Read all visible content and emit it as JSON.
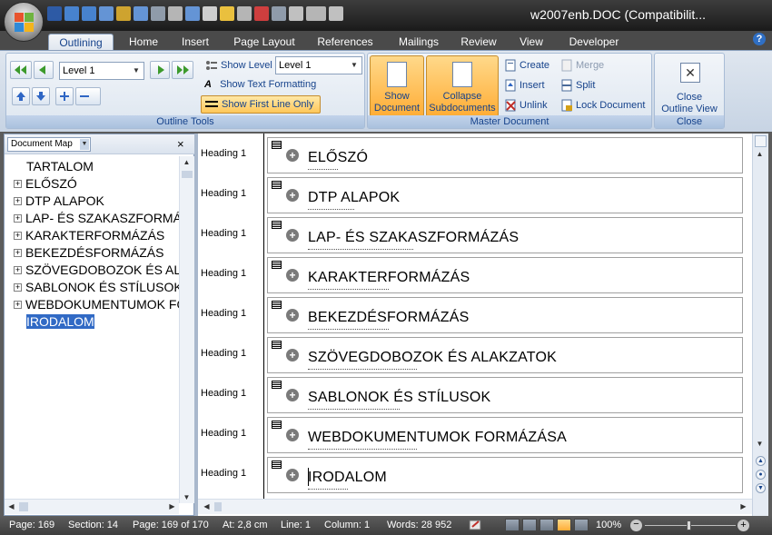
{
  "window": {
    "title": "w2007enb.DOC (Compatibilit..."
  },
  "quick_access": [
    "save-icon",
    "undo-icon",
    "redo-icon",
    "repeat-icon",
    "format-painter-icon",
    "columns-icon",
    "shape-icon",
    "pen-icon",
    "table-icon",
    "eraser-icon",
    "highlighter-icon",
    "border-icon",
    "font-color-icon",
    "paste-icon",
    "select-icon",
    "lines-icon",
    "more-icon"
  ],
  "tabs": [
    {
      "label": "Outlining",
      "active": true
    },
    {
      "label": "Home"
    },
    {
      "label": "Insert"
    },
    {
      "label": "Page Layout"
    },
    {
      "label": "References"
    },
    {
      "label": "Mailings"
    },
    {
      "label": "Review"
    },
    {
      "label": "View"
    },
    {
      "label": "Developer"
    }
  ],
  "ribbon": {
    "outline_tools": {
      "level_value": "Level 1",
      "show_level_label": "Show Level",
      "show_level_value": "Level 1",
      "show_text_formatting": "Show Text Formatting",
      "show_first_line_only": "Show First Line Only",
      "group_label": "Outline Tools"
    },
    "master_document": {
      "show_document_line1": "Show",
      "show_document_line2": "Document",
      "collapse_line1": "Collapse",
      "collapse_line2": "Subdocuments",
      "create": "Create",
      "insert": "Insert",
      "unlink": "Unlink",
      "merge": "Merge",
      "split": "Split",
      "lock_document": "Lock Document",
      "group_label": "Master Document"
    },
    "close": {
      "line1": "Close",
      "line2": "Outline View",
      "group_label": "Close"
    }
  },
  "document_map": {
    "view_select": "Document Map",
    "close_symbol": "×",
    "items": [
      {
        "label": "TARTALOM",
        "expandable": false
      },
      {
        "label": "ELŐSZÓ",
        "expandable": true
      },
      {
        "label": "DTP ALAPOK",
        "expandable": true
      },
      {
        "label": "LAP- ÉS SZAKASZFORMÁZÁS",
        "expandable": true
      },
      {
        "label": "KARAKTERFORMÁZÁS",
        "expandable": true
      },
      {
        "label": "BEKEZDÉSFORMÁZÁS",
        "expandable": true
      },
      {
        "label": "SZÖVEGDOBOZOK ÉS ALAKZATOK",
        "expandable": true
      },
      {
        "label": "SABLONOK ÉS STÍLUSOK",
        "expandable": true
      },
      {
        "label": "WEBDOKUMENTUMOK FORMÁZÁSA",
        "expandable": true
      },
      {
        "label": "IRODALOM",
        "expandable": false,
        "selected": true
      }
    ]
  },
  "outline": {
    "sections": [
      {
        "style": "Heading 1",
        "heading": "ELŐSZÓ"
      },
      {
        "style": "Heading 1",
        "heading": "DTP ALAPOK"
      },
      {
        "style": "Heading 1",
        "heading": "LAP- ÉS SZAKASZFORMÁZÁS"
      },
      {
        "style": "Heading 1",
        "heading": "KARAKTERFORMÁZÁS"
      },
      {
        "style": "Heading 1",
        "heading": "BEKEZDÉSFORMÁZÁS"
      },
      {
        "style": "Heading 1",
        "heading": "SZÖVEGDOBOZOK ÉS ALAKZATOK"
      },
      {
        "style": "Heading 1",
        "heading": "SABLONOK ÉS STÍLUSOK"
      },
      {
        "style": "Heading 1",
        "heading": "WEBDOKUMENTUMOK FORMÁZÁSA"
      },
      {
        "style": "Heading 1",
        "heading": "IRODALOM"
      }
    ]
  },
  "status": {
    "page": "Page: 169",
    "section": "Section: 14",
    "page_of": "Page: 169 of 170",
    "at": "At: 2,8 cm",
    "line": "Line: 1",
    "column": "Column: 1",
    "words": "Words: 28 952",
    "zoom": "100%"
  },
  "colors": {
    "ribbon_accent": "#15428b",
    "selected_highlight": "#316ac5",
    "hot_button": "#ffad36"
  }
}
